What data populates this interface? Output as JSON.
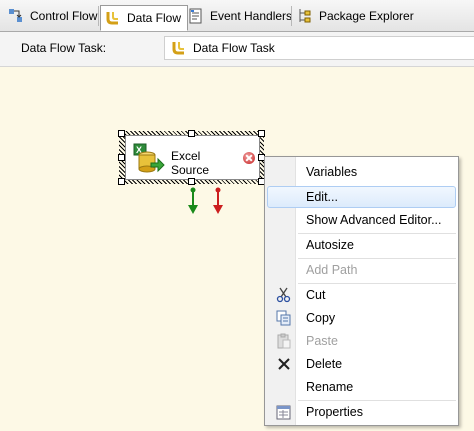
{
  "tabs": [
    {
      "label": "Control Flow",
      "icon": "control-flow-icon",
      "active": false
    },
    {
      "label": "Data Flow",
      "icon": "data-flow-icon",
      "active": true
    },
    {
      "label": "Event Handlers",
      "icon": "event-handlers-icon",
      "active": false
    },
    {
      "label": "Package Explorer",
      "icon": "package-explorer-icon",
      "active": false
    }
  ],
  "task": {
    "label": "Data Flow Task:",
    "selected": "Data Flow Task"
  },
  "component": {
    "line1": "Excel",
    "line2": "Source"
  },
  "context_menu": {
    "items": [
      {
        "label": "Variables",
        "enabled": true
      },
      {
        "label": "Edit...",
        "enabled": true,
        "highlighted": true
      },
      {
        "label": "Show Advanced Editor...",
        "enabled": true
      },
      {
        "label": "Autosize",
        "enabled": true
      },
      {
        "label": "Add Path",
        "enabled": false
      },
      {
        "label": "Cut",
        "enabled": true,
        "icon": "scissors-icon"
      },
      {
        "label": "Copy",
        "enabled": true,
        "icon": "copy-icon"
      },
      {
        "label": "Paste",
        "enabled": false,
        "icon": "paste-icon"
      },
      {
        "label": "Delete",
        "enabled": true,
        "icon": "delete-icon"
      },
      {
        "label": "Rename",
        "enabled": true
      },
      {
        "label": "Properties",
        "enabled": true,
        "icon": "properties-icon"
      }
    ]
  },
  "colors": {
    "canvas": "#fdf9e6",
    "highlight": "#dcebfc",
    "green_arrow": "#1a8a1a",
    "red_arrow": "#cc1f1f"
  }
}
